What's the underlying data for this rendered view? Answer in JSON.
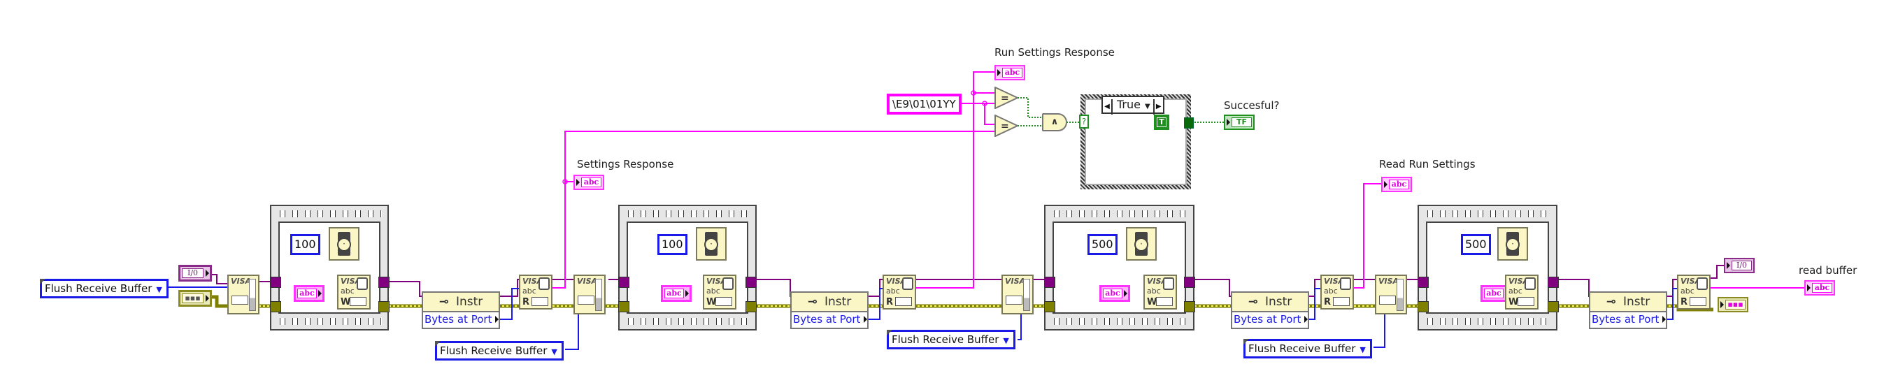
{
  "diagram": {
    "type": "LabVIEW block diagram",
    "colors": {
      "io_wire": "#800080",
      "error_wire": "#8a8a20",
      "string_wire": "#ff00ff",
      "numeric_wire": "#1a1ae6",
      "boolean_wire": "#1f8f1f",
      "node_fill": "#fbf6c6"
    }
  },
  "inputs": {
    "visa_resource_control": "I/0",
    "error_in_control": "error in",
    "flush_mask_1": "Flush Receive Buffer"
  },
  "stages": [
    {
      "flush": {
        "node": "VISA Flush I/O Buffer",
        "label": "VISA"
      },
      "sequence": {
        "wait_ms": "100",
        "write_node": {
          "line1": "VISA",
          "line2": "abc",
          "mode": "W"
        },
        "write_string": "abc"
      },
      "property": {
        "class": "Instr",
        "property": "Bytes at Port"
      },
      "read": {
        "line1": "VISA",
        "line2": "abc",
        "mode": "R"
      },
      "indicator": {
        "label": "Settings Response",
        "glyph": "abc"
      },
      "flush_mask": "Flush Receive Buffer"
    },
    {
      "flush": {
        "label": "VISA"
      },
      "sequence": {
        "wait_ms": "100",
        "write_node": {
          "line1": "VISA",
          "line2": "abc",
          "mode": "W"
        },
        "write_string": "abc"
      },
      "property": {
        "class": "Instr",
        "property": "Bytes at Port"
      },
      "read": {
        "line1": "VISA",
        "line2": "abc",
        "mode": "R"
      },
      "indicator": {
        "label": "Run Settings Response",
        "glyph": "abc"
      },
      "flush_mask": "Flush Receive Buffer"
    },
    {
      "flush": {
        "label": "VISA"
      },
      "sequence": {
        "wait_ms": "500",
        "write_node": {
          "line1": "VISA",
          "line2": "abc",
          "mode": "W"
        },
        "write_string": "abc"
      },
      "property": {
        "class": "Instr",
        "property": "Bytes at Port"
      },
      "read": {
        "line1": "VISA",
        "line2": "abc",
        "mode": "R"
      },
      "indicator": {
        "label": "Read Run Settings",
        "glyph": "abc"
      },
      "flush_mask": "Flush Receive Buffer"
    },
    {
      "flush": {
        "label": "VISA"
      },
      "sequence": {
        "wait_ms": "500",
        "write_node": {
          "line1": "VISA",
          "line2": "abc",
          "mode": "W"
        },
        "write_string": "abc"
      },
      "property": {
        "class": "Instr",
        "property": "Bytes at Port"
      },
      "read": {
        "line1": "VISA",
        "line2": "abc",
        "mode": "R"
      }
    }
  ],
  "compare": {
    "string_constant": "\\E9\\01\\01YY",
    "eq_symbol": "=",
    "and_symbol": "∧",
    "case_selector_value": "True",
    "case_terminal": "?",
    "true_constant": "T",
    "result_indicator": {
      "label": "Succesful?",
      "glyph": "TF"
    }
  },
  "outputs": {
    "visa_out": "I/0",
    "read_buffer": {
      "label": "read buffer",
      "glyph": "abc"
    },
    "error_out": "error out"
  }
}
